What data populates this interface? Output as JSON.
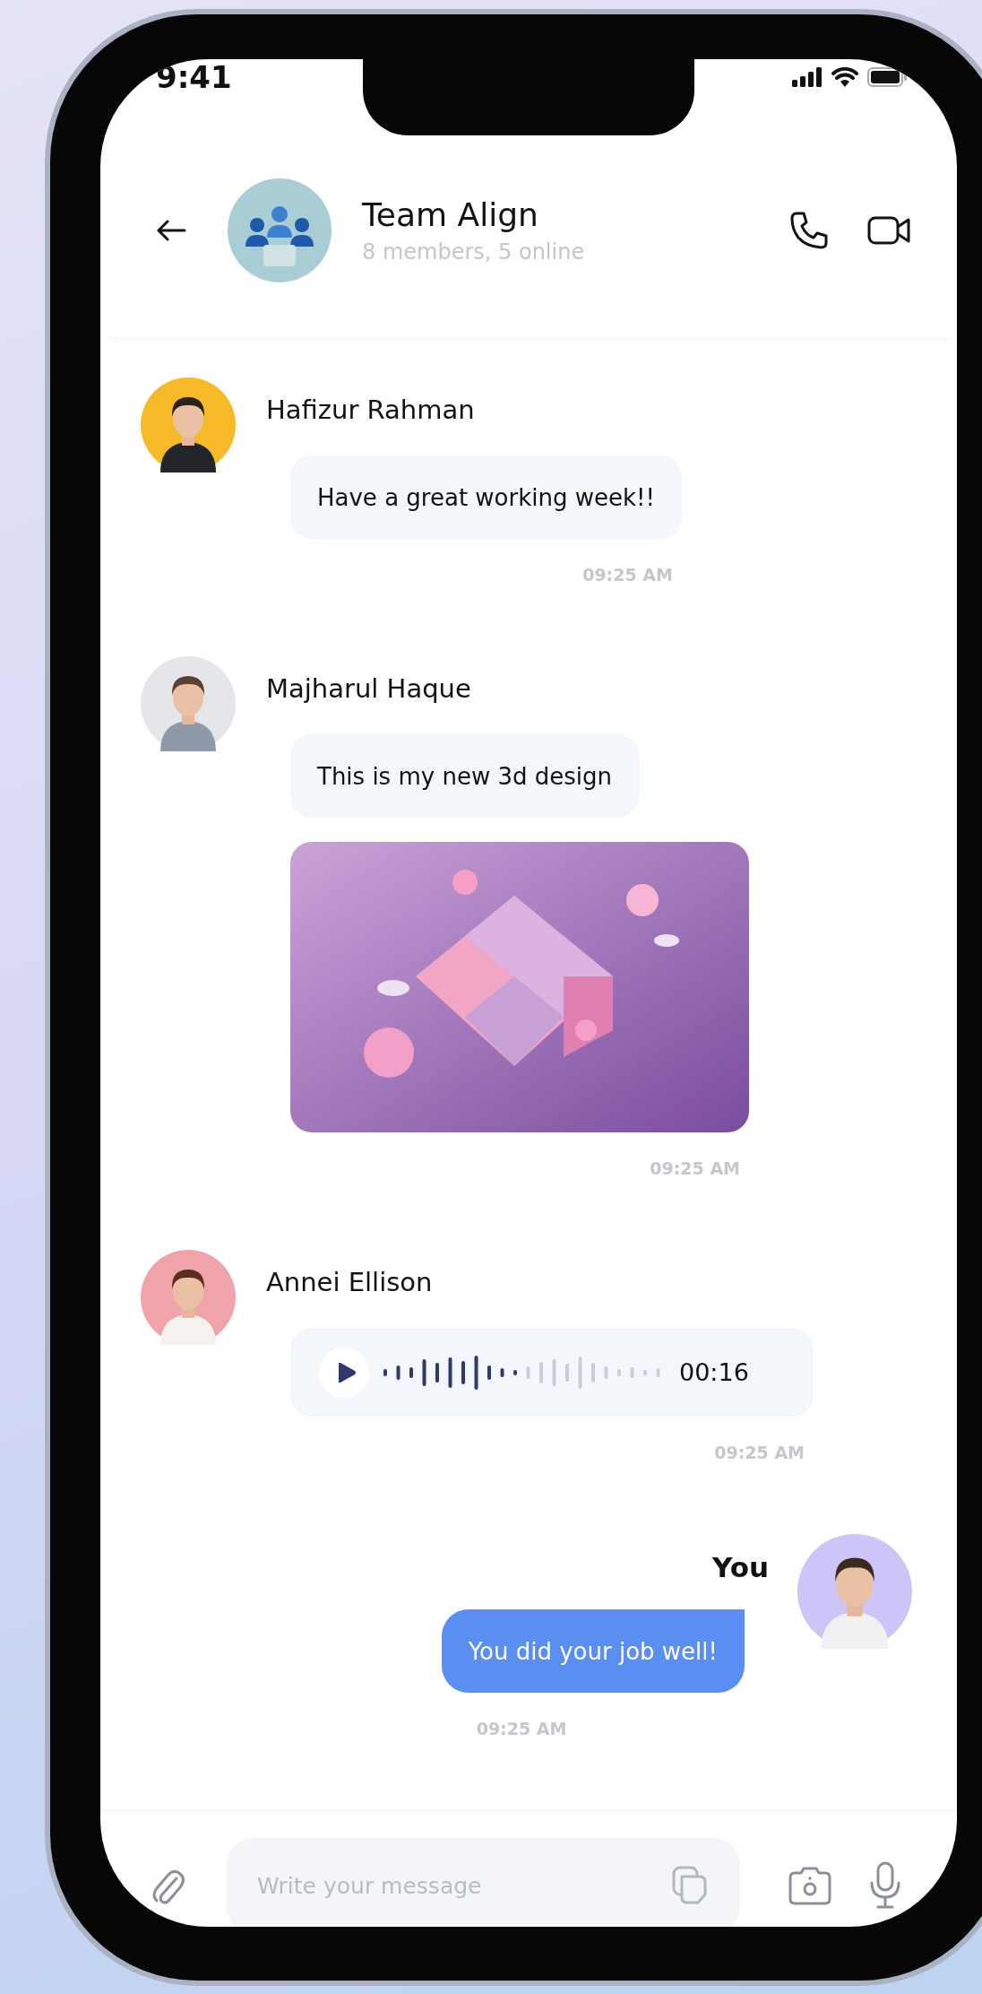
{
  "status_bar": {
    "time": "9:41"
  },
  "header": {
    "title": "Team Align",
    "subtitle": "8 members, 5 online"
  },
  "messages": [
    {
      "kind": "text",
      "sender": "Hafizur Rahman",
      "text": "Have a great working week!!",
      "time": "09:25 AM"
    },
    {
      "sender": "Majharul Haque",
      "text": "This is my new 3d design",
      "time": "09:25 AM"
    },
    {
      "kind": "voice",
      "sender": "Annei Ellison",
      "duration": "00:16",
      "level": 0.5,
      "time": "09:25 AM"
    },
    {
      "kind": "outgoing",
      "sender": "You",
      "text": "You did your job well!",
      "time": "09:25 AM"
    }
  ],
  "composer": {
    "placeholder": "Write your message"
  }
}
